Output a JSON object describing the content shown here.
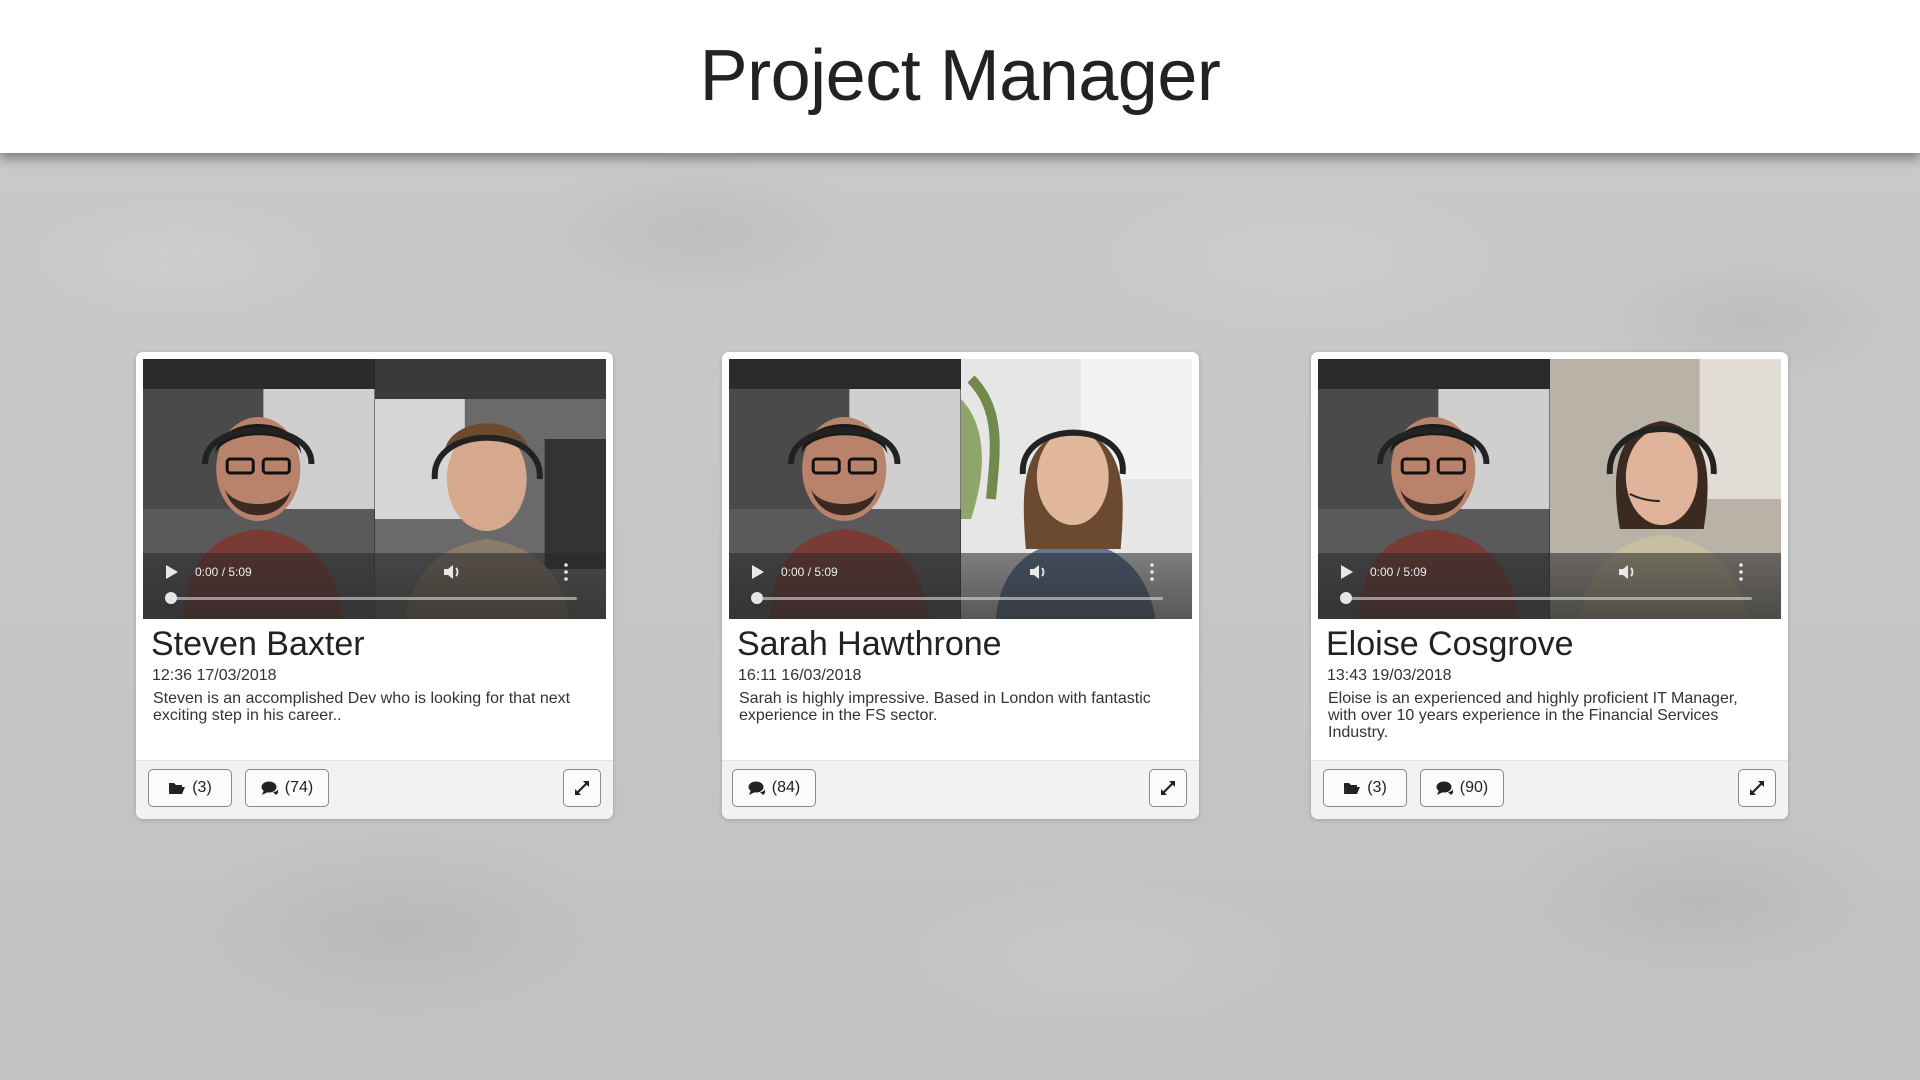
{
  "page": {
    "title": "Project Manager"
  },
  "candidates": [
    {
      "name": "Steven Baxter",
      "timestamp": "12:36 17/03/2018",
      "description": "Steven is an accomplished Dev who is looking for that next exciting step in his career..",
      "video_time": "0:00 / 5:09",
      "folder_count": "(3)",
      "comment_count": "(74)",
      "progress": 0
    },
    {
      "name": "Sarah Hawthrone",
      "timestamp": "16:11 16/03/2018",
      "description": "Sarah is highly impressive. Based in London with fantastic experience in the FS sector.",
      "video_time": "0:00 / 5:09",
      "comment_count": "(84)",
      "progress": 0
    },
    {
      "name": "Eloise Cosgrove",
      "timestamp": "13:43 19/03/2018",
      "description": "Eloise is an experienced and highly proficient IT Manager, with over 10 years experience in the Financial Services Industry.",
      "video_time": "0:00 / 5:09",
      "folder_count": "(3)",
      "comment_count": "(90)",
      "progress": 0
    }
  ],
  "icons": {
    "folder": "folder-open-icon",
    "comments": "comments-icon",
    "expand": "expand-icon",
    "play": "play-icon",
    "volume": "volume-icon",
    "more": "more-vertical-icon"
  }
}
